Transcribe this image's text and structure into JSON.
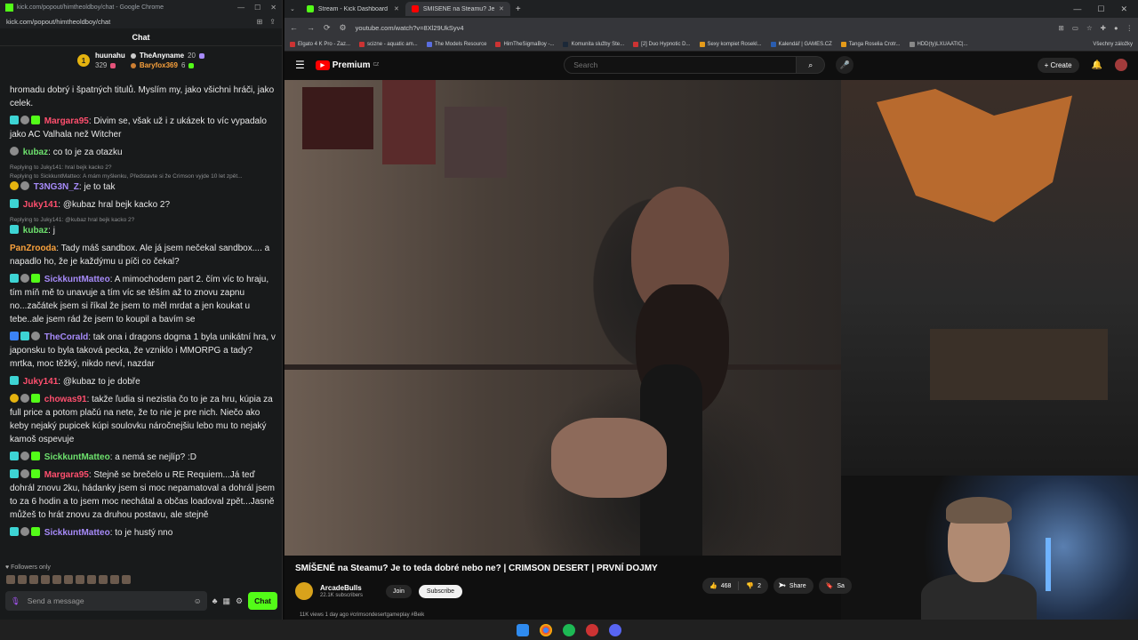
{
  "chat_window": {
    "title": "kick.com/popout/himtheoldboy/chat - Google Chrome",
    "url": "kick.com/popout/himtheoldboy/chat",
    "header": "Chat",
    "leaderboard": {
      "first": {
        "name": "huunahu",
        "count": "329"
      },
      "second": {
        "name": "TheAnyname",
        "count": "20"
      },
      "third": {
        "name": "Baryfox369",
        "count": "6"
      }
    },
    "messages": [
      {
        "reply": "",
        "user": "",
        "text": "hromadu dobrý i špatných titulů. Myslím my, jako všichni hráči, jako celek.",
        "color": ""
      },
      {
        "reply": "",
        "user": "Margara95",
        "text": "Divim se, však už i z ukázek to víc vypadalo jako AC Valhala než Witcher",
        "color": "pink"
      },
      {
        "reply": "",
        "user": "kubaz",
        "text": "co to je za otazku",
        "color": "green"
      },
      {
        "reply": "Replying to Juky141: hral bejk kacko 2?",
        "user": "",
        "text": "",
        "color": ""
      },
      {
        "reply": "Replying to SickkuntMatteo: A mám myšlenku, Představte si že Crimson vyjde 10 let zpět...",
        "user": "T3NG3N_Z",
        "text": "je to tak",
        "color": "violet"
      },
      {
        "reply": "",
        "user": "Juky141",
        "text": "@kubaz hral bejk kacko 2?",
        "color": "pink"
      },
      {
        "reply": "Replying to Juky141: @kubaz hral bejk kacko 2?",
        "user": "kubaz",
        "text": "j",
        "color": "green"
      },
      {
        "reply": "",
        "user": "PanZrooda",
        "text": "Tady máš sandbox. Ale já jsem nečekal sandbox.... a napadlo ho, že je každýmu u píči co čekal?",
        "color": "orange"
      },
      {
        "reply": "",
        "user": "SickkuntMatteo",
        "text": "A mimochodem part 2. čím víc to hraju, tím míň mě to unavuje a tím víc se těším až to znovu zapnu no...začátek jsem si říkal že jsem to měl mrdat a jen koukat u tebe..ale jsem rád že jsem to koupil a bavím se",
        "color": "violet"
      },
      {
        "reply": "",
        "user": "TheCorald",
        "text": "tak ona i dragons dogma 1 byla unikátní hra, v japonsku to byla taková pecka, že vzniklo i MMORPG a tady? mrtka, moc těžký, nikdo neví, nazdar",
        "color": "violet"
      },
      {
        "reply": "",
        "user": "Juky141",
        "text": "@kubaz to je dobře",
        "color": "pink"
      },
      {
        "reply": "",
        "user": "chowas91",
        "text": "takže ľudia si nezistia čo to je za hru, kúpia za full price a potom plačú na nete, že to nie je pre nich. Niečo ako keby nejaký pupicek kúpi soulovku náročnejšiu lebo mu to nejaký kamoš ospevuje",
        "color": "pink"
      },
      {
        "reply": "",
        "user": "SickkuntMatteo",
        "text": "a nemá se nejlíp? :D",
        "color": "green"
      },
      {
        "reply": "",
        "user": "Margara95",
        "text": "Stejně se brečelo u RE Requiem...Já teď dohrál znovu 2ku, hádanky jsem si moc nepamatoval a dohrál jsem to za 6 hodin a to jsem moc nechátal a občas loadoval zpět...Jasně můžeš to hrát znovu za druhou postavu, ale stejně",
        "color": "pink"
      },
      {
        "reply": "",
        "user": "SickkuntMatteo",
        "text": "to je hustý nno",
        "color": "violet"
      }
    ],
    "followers_only": "Followers only",
    "input_placeholder": "Send a message",
    "send_label": "Chat"
  },
  "browser": {
    "tabs": [
      {
        "title": "Stream - Kick Dashboard",
        "color": "#53fc18"
      },
      {
        "title": "SMÍŠENÉ na Steamu? Je to tedy...",
        "color": "#ff0000"
      }
    ],
    "url": "youtube.com/watch?v=8Xl29UkSyv4",
    "bookmarks": [
      "Elgato 4 K Pro - Zaz...",
      "scizne - aquatic am...",
      "The Models Resource",
      "HimTheSigmaBoy -...",
      "Komunita služby Ste...",
      "[2] Duo Hypnotic D...",
      "Sexy kompiet Rosekl...",
      "Kalendář | GAMES.CZ",
      "Tanga Roselia Crotr...",
      "HDD(ty)LXUAATIC|..."
    ],
    "all_bookmarks": "Všechny záložky"
  },
  "youtube": {
    "logo": "Premium",
    "region": "CZ",
    "search_placeholder": "Search",
    "create_label": "Create",
    "video_title": "SMÍŠENÉ na Steamu? Je to teda dobré nebo ne? | CRIMSON DESERT | PRVNÍ DOJMY",
    "channel_name": "ArcadeBulls",
    "subscribers": "22.1K subscribers",
    "join_label": "Join",
    "subscribe_label": "Subscribe",
    "likes": "468",
    "dislikes": "2",
    "share_label": "Share",
    "save_label": "Sa",
    "views_line": "11K views  1 day ago  #crimsondesertgameplay #Beik"
  }
}
